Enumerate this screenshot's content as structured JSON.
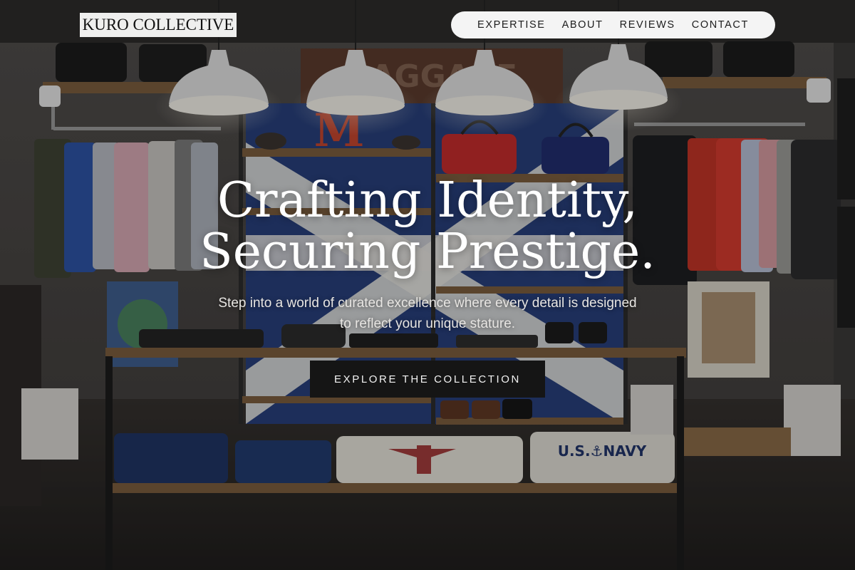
{
  "brand": {
    "name": "KURO COLLECTIVE"
  },
  "nav": {
    "items": [
      {
        "label": "EXPERTISE"
      },
      {
        "label": "ABOUT"
      },
      {
        "label": "REVIEWS"
      },
      {
        "label": "CONTACT"
      }
    ]
  },
  "hero": {
    "headline_line1": "Crafting Identity,",
    "headline_line2": "Securing Prestige.",
    "subtext_line1": "Step into a world of curated excellence where every detail is designed",
    "subtext_line2": "to reflect your unique stature.",
    "cta_label": "EXPLORE THE COLLECTION",
    "background_sign_text": "BAGGAGE",
    "background_letter": "M",
    "background_shirt_text": "U.S.⚓NAVY"
  },
  "colors": {
    "nav_bg": "#f4f4f4",
    "logo_bg": "#efefee",
    "cta_bg": "#151515",
    "headline": "#ffffff"
  }
}
